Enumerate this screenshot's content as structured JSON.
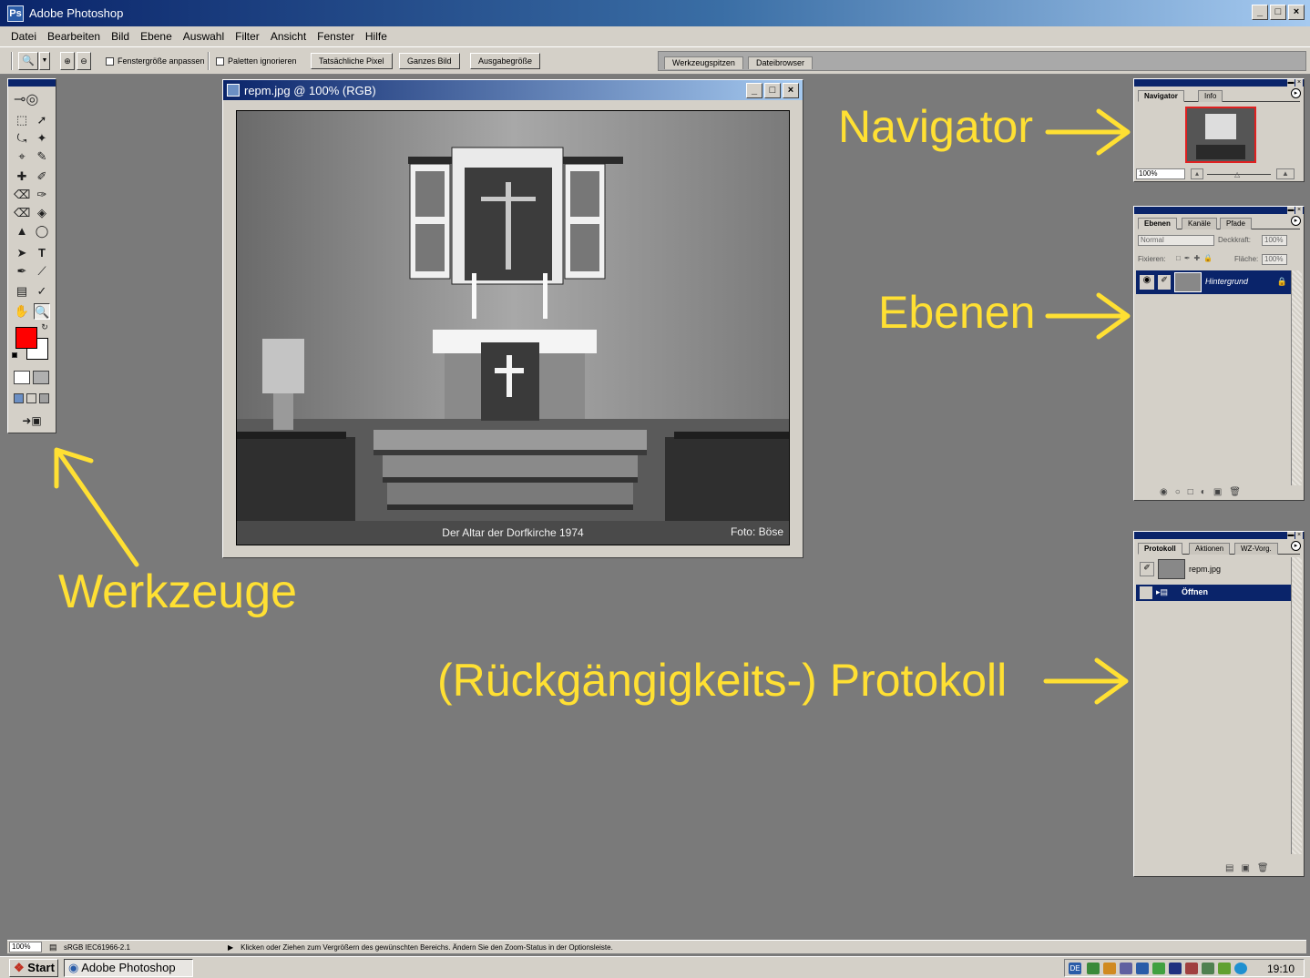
{
  "app": {
    "title": "Adobe Photoshop",
    "window_buttons": [
      "_",
      "□",
      "×"
    ]
  },
  "menubar": {
    "items": [
      "Datei",
      "Bearbeiten",
      "Bild",
      "Ebene",
      "Auswahl",
      "Filter",
      "Ansicht",
      "Fenster",
      "Hilfe"
    ]
  },
  "options": {
    "fit_window_label": "Fenstergröße anpassen",
    "ignore_palettes_label": "Paletten ignorieren",
    "actual_pixels_label": "Tatsächliche Pixel",
    "fit_screen_label": "Ganzes Bild",
    "print_size_label": "Ausgabegröße",
    "well_tabs": [
      "Werkzeugspitzen",
      "Dateibrowser"
    ]
  },
  "document": {
    "title": "repm.jpg @ 100% (RGB)",
    "caption": "Der Altar der Dorfkirche 1974",
    "credit": "Foto: Böse"
  },
  "navigator": {
    "tabs": [
      "Navigator",
      "Info"
    ],
    "zoom_value": "100%"
  },
  "layers": {
    "tabs": [
      "Ebenen",
      "Kanäle",
      "Pfade"
    ],
    "blend_mode": "Normal",
    "opacity_label": "Deckkraft:",
    "opacity_value": "100%",
    "lock_label": "Fixieren:",
    "fill_label": "Fläche:",
    "fill_value": "100%",
    "layer_name": "Hintergrund"
  },
  "history": {
    "tabs": [
      "Protokoll",
      "Aktionen",
      "WZ-Vorg."
    ],
    "snapshot_name": "repm.jpg",
    "step_name": "Öffnen"
  },
  "annotations": {
    "navigator": "Navigator",
    "layers": "Ebenen",
    "tools": "Werkzeuge",
    "history": "(Rückgängigkeits-) Protokoll"
  },
  "status": {
    "zoom": "100%",
    "profile": "sRGB IEC61966-2.1",
    "hint": "Klicken oder Ziehen zum Vergrößern des gewünschten Bereichs. Ändern Sie den Zoom-Status in der Optionsleiste."
  },
  "taskbar": {
    "start_label": "Start",
    "task_label": "Adobe Photoshop",
    "lang": "DE",
    "clock": "19:10"
  },
  "colors": {
    "foreground": "#ff0000",
    "background": "#ffffff",
    "annotation": "#ffe033",
    "selection": "#0a246a"
  }
}
